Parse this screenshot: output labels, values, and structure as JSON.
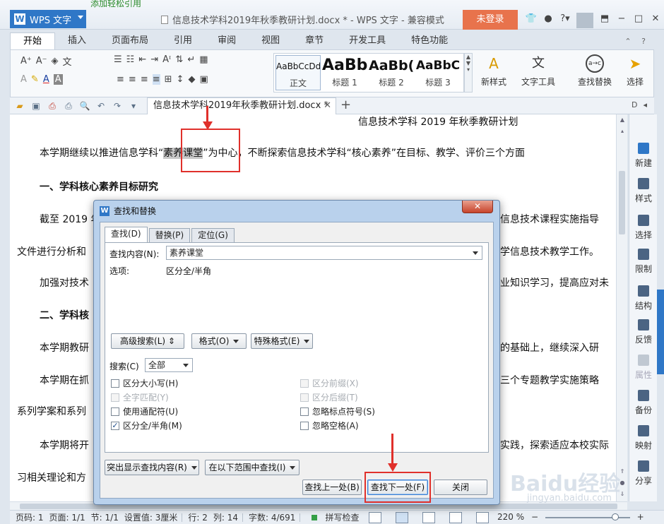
{
  "titlebar": {
    "app_name": "WPS 文字",
    "promo_text": "添加轻松引用",
    "doc_title": "信息技术学科2019年秋季教研计划.docx * - WPS 文字 - 兼容模式",
    "login_label": "未登录",
    "icons": [
      "shirt-icon",
      "chat-icon",
      "help-icon",
      "restore-icon",
      "minimize-icon",
      "maximize-icon",
      "close-icon"
    ]
  },
  "ribbon": {
    "tabs": [
      "开始",
      "插入",
      "页面布局",
      "引用",
      "审阅",
      "视图",
      "章节",
      "开发工具",
      "特色功能"
    ],
    "styles": [
      {
        "preview": "AaBbCcDd",
        "name": "正文"
      },
      {
        "preview": "AaBb",
        "name": "标题 1"
      },
      {
        "preview": "AaBb(",
        "name": "标题 2"
      },
      {
        "preview": "AaBbC",
        "name": "标题 3"
      }
    ],
    "new_style": "新样式",
    "text_tools": "文字工具",
    "find_replace": "查找替换",
    "select": "选择"
  },
  "doc_tab": {
    "label": "信息技术学科2019年秋季教研计划.docx *"
  },
  "document": {
    "title": "信息技术学科 2019 年秋季教研计划",
    "p1_a": "本学期继续以推进信息学科“",
    "p1_hl": "素养课堂",
    "p1_b": "”为中心，不断探索信息技术学科“核心素养”在目标、教学、评价三个方面",
    "h1": "一、学科核心素养目标研究",
    "p2_a": "截至 2019 年",
    "p2_b": "信息技术课程实施指导",
    "p2_c": "文件进行分析和",
    "p2_d": "学信息技术教学工作。",
    "p3_a": "加强对技术",
    "p3_b": "业知识学习，提高应对未",
    "h2": "二、学科核",
    "p4_a": "本学期教研",
    "p4_b": "的基础上，继续深入研",
    "p5_a": "本学期在抓",
    "p5_b": "三个专题教学实施策略",
    "p5_c": "系列学案和系列",
    "p6_a": "本学期将开",
    "p6_b": "实践，探索适应本校实际",
    "p6_c": "习相关理论和方"
  },
  "right_panel": [
    "新建",
    "样式",
    "选择",
    "限制",
    "结构",
    "反馈",
    "属性",
    "备份",
    "映射",
    "分享"
  ],
  "dialog": {
    "title": "查找和替换",
    "tabs": [
      "查找(D)",
      "替换(P)",
      "定位(G)"
    ],
    "find_label": "查找内容(N):",
    "find_value": "素养课堂",
    "options_label": "选项:",
    "options_value": "区分全/半角",
    "advanced_btn": "高级搜索(L)",
    "format_btn": "格式(O)",
    "special_btn": "特殊格式(E)",
    "search_label": "搜索(C)",
    "search_value": "全部",
    "checks_left": [
      {
        "label": "区分大小写(H)",
        "checked": false,
        "disabled": false
      },
      {
        "label": "全字匹配(Y)",
        "checked": false,
        "disabled": true
      },
      {
        "label": "使用通配符(U)",
        "checked": false,
        "disabled": false
      },
      {
        "label": "区分全/半角(M)",
        "checked": true,
        "disabled": false
      }
    ],
    "checks_right": [
      {
        "label": "区分前缀(X)",
        "checked": false,
        "disabled": true
      },
      {
        "label": "区分后缀(T)",
        "checked": false,
        "disabled": true
      },
      {
        "label": "忽略标点符号(S)",
        "checked": false,
        "disabled": false
      },
      {
        "label": "忽略空格(A)",
        "checked": false,
        "disabled": false
      }
    ],
    "highlight_btn": "突出显示查找内容(R)",
    "scope_btn": "在以下范围中查找(I)",
    "prev_btn": "查找上一处(B)",
    "next_btn": "查找下一处(F)",
    "close_btn": "关闭"
  },
  "status": {
    "page": "页码: 1",
    "pages": "页面: 1/1",
    "section": "节: 1/1",
    "setting": "设置值: 3厘米",
    "row": "行: 2",
    "col": "列: 14",
    "words": "字数: 4/691",
    "spell": "拼写检查",
    "zoom": "220 %"
  },
  "watermark": {
    "brand": "Baidu经验",
    "url": "jingyan.baidu.com"
  },
  "colors": {
    "accent": "#2f77c7",
    "login": "#e8734c",
    "annotation": "#e0302b"
  }
}
